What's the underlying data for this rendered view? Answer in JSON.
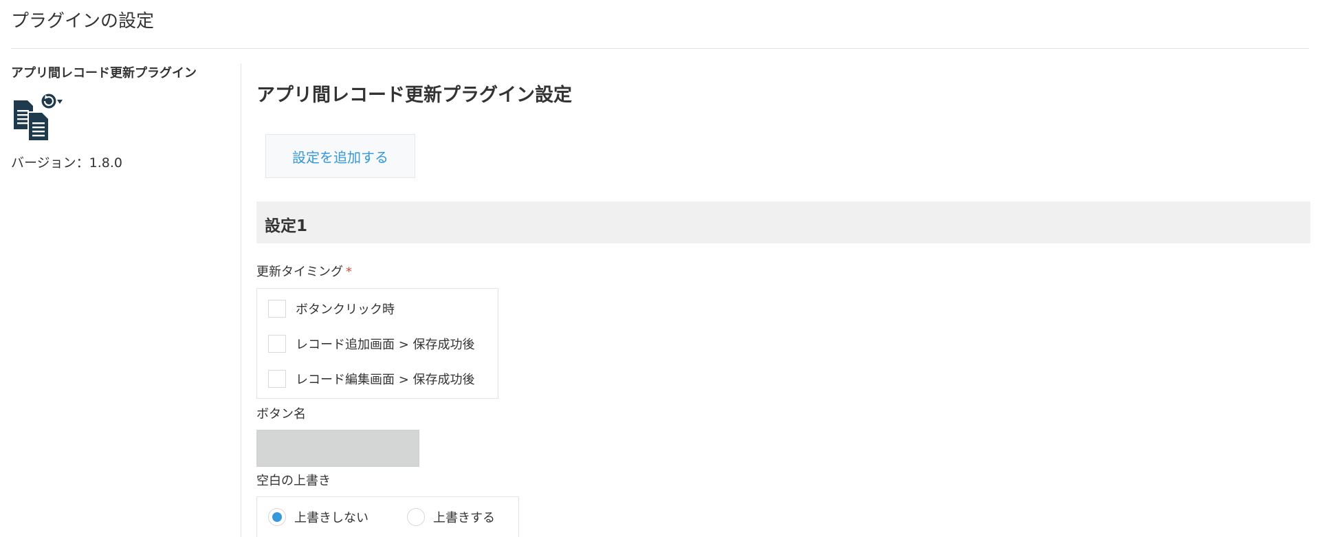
{
  "header": {
    "title": "プラグインの設定"
  },
  "sidebar": {
    "plugin_name": "アプリ間レコード更新プラグイン",
    "icon": "copy-documents-refresh-icon",
    "version_text": "バージョン：1.8.0"
  },
  "main": {
    "title": "アプリ間レコード更新プラグイン設定",
    "add_button_label": "設定を追加する",
    "setting": {
      "title": "設定1",
      "update_timing": {
        "label": "更新タイミング",
        "required_mark": "*",
        "options": [
          {
            "label": "ボタンクリック時",
            "checked": false
          },
          {
            "label": "レコード追加画面 > 保存成功後",
            "checked": false
          },
          {
            "label": "レコード編集画面 > 保存成功後",
            "checked": false
          }
        ]
      },
      "button_name": {
        "label": "ボタン名",
        "value": "",
        "disabled": true
      },
      "blank_overwrite": {
        "label": "空白の上書き",
        "options": [
          {
            "label": "上書きしない",
            "selected": true
          },
          {
            "label": "上書きする",
            "selected": false
          }
        ]
      }
    }
  },
  "colors": {
    "accent": "#3498db",
    "required": "#e74c3c",
    "icon": "#1f3a4d",
    "section_bg": "#f0f0f0",
    "disabled_input": "#d4d6d5"
  }
}
